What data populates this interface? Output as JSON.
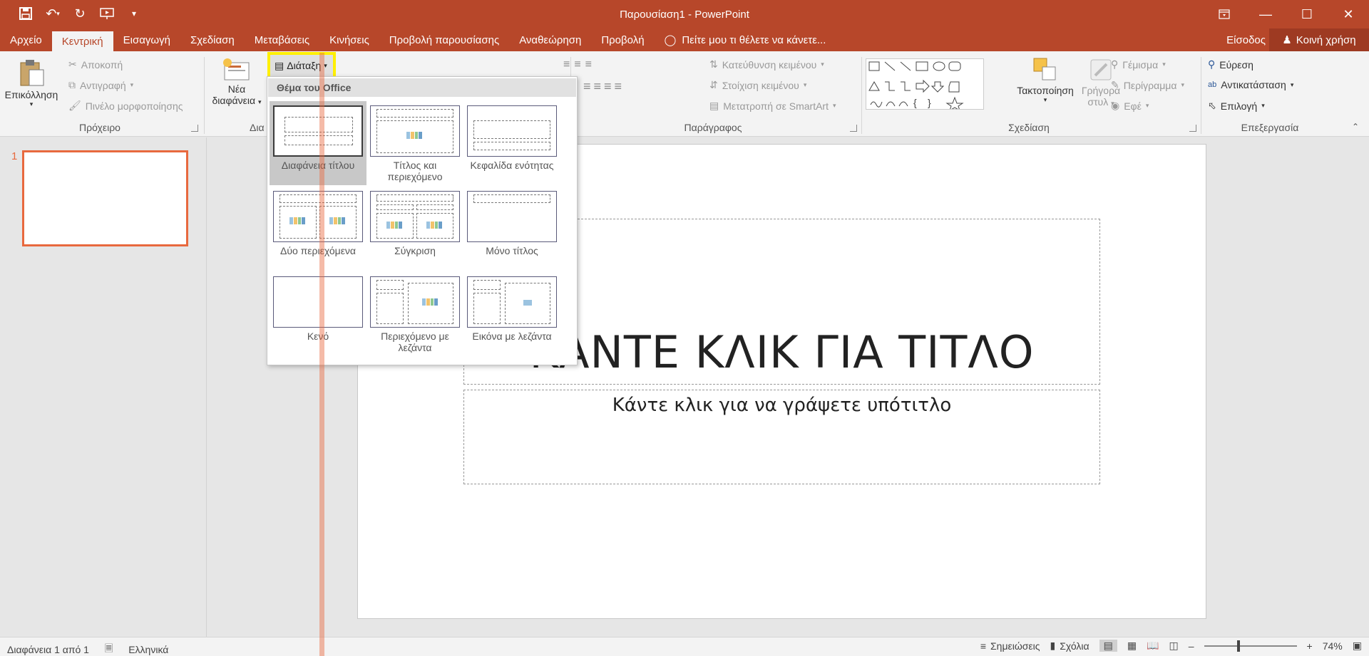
{
  "window": {
    "title": "Παρουσίαση1 - PowerPoint",
    "accent": "#b7472a"
  },
  "qat": {
    "save_icon": "save-icon",
    "undo_icon": "undo-icon",
    "redo_icon": "redo-icon",
    "present_icon": "present-from-start-icon",
    "customize_icon": "customize-qat-icon"
  },
  "tabs": {
    "items": [
      "Αρχείο",
      "Κεντρική",
      "Εισαγωγή",
      "Σχεδίαση",
      "Μεταβάσεις",
      "Κινήσεις",
      "Προβολή παρουσίασης",
      "Αναθεώρηση",
      "Προβολή"
    ],
    "active": "Κεντρική",
    "tell_me": "Πείτε μου τι θέλετε να κάνετε...",
    "signin": "Είσοδος",
    "share": "Κοινή χρήση"
  },
  "ribbon": {
    "clipboard": {
      "paste": "Επικόλληση",
      "cut": "Αποκοπή",
      "copy": "Αντιγραφή",
      "format_painter": "Πινέλο μορφοποίησης",
      "label": "Πρόχειρο"
    },
    "slides": {
      "new_slide_line1": "Νέα",
      "new_slide_line2": "διαφάνεια",
      "layout": "Διάταξη",
      "label_partial": "Δια"
    },
    "paragraph": {
      "text_direction": "Κατεύθυνση κειμένου",
      "align_text": "Στοίχιση κειμένου",
      "smartart": "Μετατροπή σε SmartArt",
      "label": "Παράγραφος"
    },
    "drawing": {
      "arrange": "Τακτοποίηση",
      "quick_styles_line1": "Γρήγορα",
      "quick_styles_line2": "στυλ",
      "fill": "Γέμισμα",
      "outline": "Περίγραμμα",
      "effects": "Εφέ",
      "label": "Σχεδίαση"
    },
    "editing": {
      "find": "Εύρεση",
      "replace": "Αντικατάσταση",
      "select": "Επιλογή",
      "label": "Επεξεργασία"
    }
  },
  "layout_menu": {
    "header": "Θέμα του Office",
    "items": [
      {
        "label": "Διαφάνεια τίτλου"
      },
      {
        "label": "Τίτλος και περιεχόμενο"
      },
      {
        "label": "Κεφαλίδα ενότητας"
      },
      {
        "label": "Δύο περιεχόμενα"
      },
      {
        "label": "Σύγκριση"
      },
      {
        "label": "Μόνο τίτλος"
      },
      {
        "label": "Κενό"
      },
      {
        "label": "Περιεχόμενο με λεζάντα"
      },
      {
        "label": "Εικόνα με λεζάντα"
      }
    ],
    "selected": "Διαφάνεια τίτλου"
  },
  "thumbnails": {
    "number": "1"
  },
  "slide": {
    "title": "ΚΑΝΤΕ ΚΛΙΚ ΓΙΑ ΤΙΤΛΟ",
    "subtitle": "Κάντε κλικ για να γράψετε υπότιτλο"
  },
  "status": {
    "slide_count": "Διαφάνεια 1 από 1",
    "language": "Ελληνικά",
    "notes": "Σημειώσεις",
    "comments": "Σχόλια",
    "zoom": "74%"
  }
}
